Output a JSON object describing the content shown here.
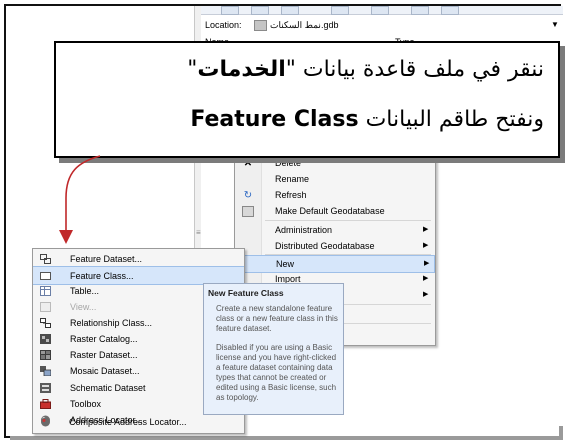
{
  "catalog": {
    "location_label": "Location:",
    "location_value": "نمط السكنات.gdb",
    "column_name": "Name",
    "column_type": "Type"
  },
  "callout": {
    "line1_prefix": "ننقر في ملف  قاعدة بيانات \"",
    "line1_bold": "الخدمات",
    "line1_suffix": "\"",
    "line2_prefix": "ونفتح طاقم البيانات  ",
    "line2_bold": "Feature Class"
  },
  "context_menu": {
    "items": [
      {
        "label": "Delete",
        "icon": "delete-icon"
      },
      {
        "label": "Rename",
        "icon": ""
      },
      {
        "label": "Refresh",
        "icon": "refresh-icon"
      },
      {
        "label": "Make Default Geodatabase",
        "icon": "geodatabase-icon"
      },
      {
        "label": "Administration",
        "icon": ""
      },
      {
        "label": "Distributed Geodatabase",
        "icon": ""
      },
      {
        "label": "New",
        "icon": ""
      },
      {
        "label": "Import",
        "icon": ""
      }
    ]
  },
  "sub_menu": {
    "items": [
      {
        "label": "Feature Dataset...",
        "icon": "feature-dataset-icon"
      },
      {
        "label": "Feature Class...",
        "icon": "feature-class-icon"
      },
      {
        "label": "Table...",
        "icon": "table-icon"
      },
      {
        "label": "View...",
        "icon": "view-icon"
      },
      {
        "label": "Relationship Class...",
        "icon": "relationship-class-icon"
      },
      {
        "label": "Raster Catalog...",
        "icon": "raster-catalog-icon"
      },
      {
        "label": "Raster Dataset...",
        "icon": "raster-dataset-icon"
      },
      {
        "label": "Mosaic Dataset...",
        "icon": "mosaic-dataset-icon"
      },
      {
        "label": "Schematic Dataset",
        "icon": "schematic-dataset-icon"
      },
      {
        "label": "Toolbox",
        "icon": "toolbox-icon"
      },
      {
        "label": "Address Locator...",
        "icon": "address-locator-icon"
      },
      {
        "label": "Composite Address Locator...",
        "icon": "composite-address-locator-icon"
      }
    ]
  },
  "tooltip": {
    "title": "New Feature Class",
    "para1": "Create a new standalone feature class or a new feature class in this feature dataset.",
    "para2": "Disabled if you are using a Basic license and you have right-clicked a feature dataset containing data types that cannot be created or edited using a Basic license, such as topology."
  },
  "colors": {
    "highlight": "#d6e6fa",
    "arrow": "#c0282a",
    "tooltip_bg": "#e8f0fb"
  }
}
